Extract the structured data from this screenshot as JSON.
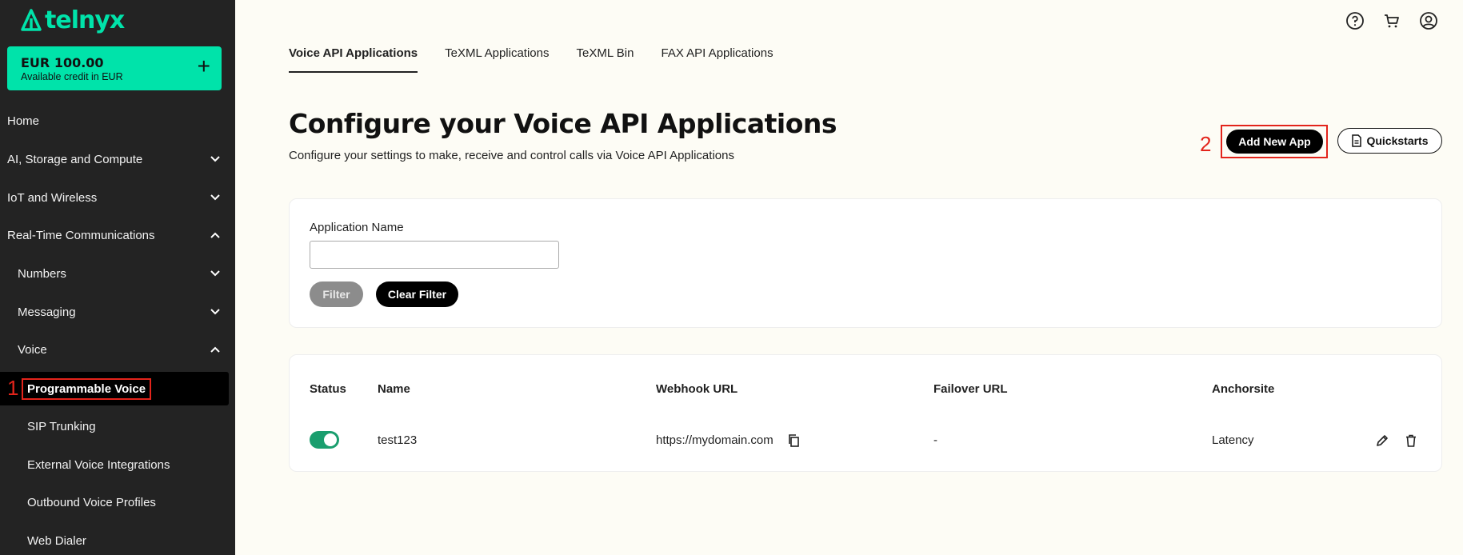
{
  "brand": {
    "name": "telnyx",
    "accent": "#00e3aa"
  },
  "credit": {
    "amount": "EUR 100.00",
    "subtitle": "Available credit in EUR",
    "add_label": "+"
  },
  "sidebar": {
    "items": [
      {
        "label": "Home"
      },
      {
        "label": "AI, Storage and Compute"
      },
      {
        "label": "IoT and Wireless"
      },
      {
        "label": "Real-Time Communications"
      },
      {
        "label": "Numbers"
      },
      {
        "label": "Messaging"
      },
      {
        "label": "Voice"
      },
      {
        "label": "Programmable Voice"
      },
      {
        "label": "SIP Trunking"
      },
      {
        "label": "External Voice Integrations"
      },
      {
        "label": "Outbound Voice Profiles"
      },
      {
        "label": "Web Dialer"
      }
    ]
  },
  "annotations": {
    "step1": "1",
    "step2": "2",
    "color": "#e3241b"
  },
  "tabs": [
    {
      "label": "Voice API Applications",
      "active": true
    },
    {
      "label": "TeXML Applications"
    },
    {
      "label": "TeXML Bin"
    },
    {
      "label": "FAX API Applications"
    }
  ],
  "page": {
    "title": "Configure your Voice API Applications",
    "subtitle": "Configure your settings to make, receive and control calls via Voice API Applications"
  },
  "actions": {
    "add_new": "Add New App",
    "quickstarts": "Quickstarts"
  },
  "filter": {
    "label": "Application Name",
    "value": "",
    "filter_button": "Filter",
    "clear_button": "Clear Filter"
  },
  "table": {
    "headers": [
      "Status",
      "Name",
      "Webhook URL",
      "Failover URL",
      "Anchorsite"
    ],
    "rows": [
      {
        "status": "on",
        "name": "test123",
        "webhook": "https://mydomain.com",
        "failover": "-",
        "anchorsite": "Latency"
      }
    ]
  },
  "top_icons": [
    "help-icon",
    "cart-icon",
    "account-icon"
  ]
}
